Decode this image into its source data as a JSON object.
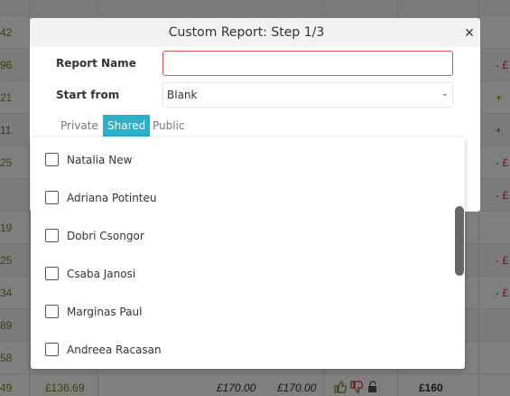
{
  "background": {
    "left_values": [
      "42",
      "96",
      "21",
      "11",
      "25",
      "19",
      "25",
      "34",
      "89",
      "58"
    ],
    "right_values": [
      "- £",
      "+",
      "+",
      "- £",
      "- £",
      "- £",
      "- £"
    ],
    "bottom_row": {
      "left": "49",
      "amount1": "£136.69",
      "amount2": "£170.00",
      "amount3": "£170.00",
      "amount4": "£160"
    }
  },
  "modal": {
    "title": "Custom Report: Step 1/3",
    "close_glyph": "×",
    "report_name_label": "Report Name",
    "report_name_value": "",
    "start_from_label": "Start from",
    "start_from_value": "Blank",
    "tabs": [
      "Private",
      "Shared",
      "Public"
    ],
    "active_tab": "Shared"
  },
  "user_list": [
    {
      "name": "Natalia New",
      "checked": false
    },
    {
      "name": "Adriana Potinteu",
      "checked": false
    },
    {
      "name": "Dobri Csongor",
      "checked": false
    },
    {
      "name": "Csaba Janosi",
      "checked": false
    },
    {
      "name": "Marginas Paul",
      "checked": false
    },
    {
      "name": "Andreea Racasan",
      "checked": false
    }
  ],
  "colors": {
    "accent": "#2bb0c9",
    "error_border": "#d9534f",
    "positive": "#6e8f14",
    "negative": "#d9351f"
  }
}
